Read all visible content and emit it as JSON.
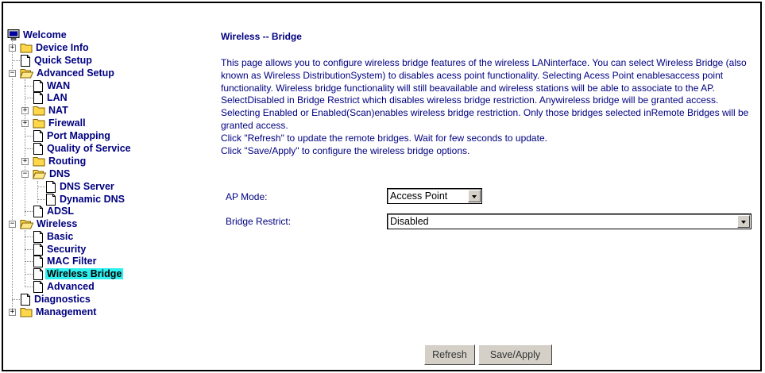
{
  "sidebar": {
    "welcome": "Welcome",
    "items": {
      "device_info": "Device Info",
      "quick_setup": "Quick Setup",
      "advanced_setup": "Advanced Setup",
      "wan": "WAN",
      "lan": "LAN",
      "nat": "NAT",
      "firewall": "Firewall",
      "port_mapping": "Port Mapping",
      "qos": "Quality of Service",
      "routing": "Routing",
      "dns": "DNS",
      "dns_server": "DNS Server",
      "dynamic_dns": "Dynamic DNS",
      "adsl": "ADSL",
      "wireless": "Wireless",
      "basic": "Basic",
      "security": "Security",
      "mac_filter": "MAC Filter",
      "wireless_bridge": "Wireless Bridge",
      "advanced": "Advanced",
      "diagnostics": "Diagnostics",
      "management": "Management"
    },
    "selected": "Wireless Bridge"
  },
  "main": {
    "title": "Wireless -- Bridge",
    "paragraph1": "This page allows you to configure wireless bridge features of the wireless LANinterface. You can select Wireless Bridge (also known as Wireless DistributionSystem) to disables acess point functionality. Selecting Acess Point enablesaccess point functionality. Wireless bridge functionality will still beavailable and wireless stations will be able to associate to the AP. SelectDisabled in Bridge Restrict which disables wireless bridge restriction. Anywireless bridge will be granted access. Selecting Enabled or Enabled(Scan)enables wireless bridge restriction. Only those bridges selected inRemote Bridges will be granted access.",
    "paragraph2": "Click \"Refresh\" to update the remote bridges. Wait for few seconds to update.",
    "paragraph3": "Click \"Save/Apply\" to configure the wireless bridge options.",
    "ap_mode_label": "AP Mode:",
    "ap_mode_value": "Access Point",
    "bridge_restrict_label": "Bridge Restrict:",
    "bridge_restrict_value": "Disabled",
    "refresh_button": "Refresh",
    "save_apply_button": "Save/Apply"
  },
  "colors": {
    "link_text": "#000080",
    "selected_highlight": "#2df0f0",
    "folder": "#ffd84a"
  }
}
